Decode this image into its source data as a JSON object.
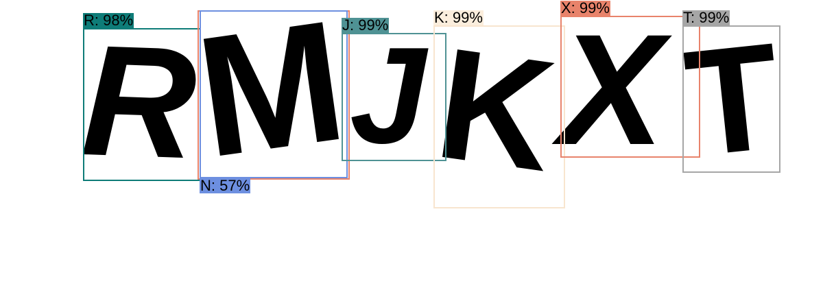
{
  "detections": [
    {
      "letter": "R",
      "label": "R: 98%",
      "color": "#0e7c78"
    },
    {
      "letter": "M",
      "label": "",
      "color": "#e8836b"
    },
    {
      "letter": "N",
      "label": "N: 57%",
      "color": "#6d8fe0"
    },
    {
      "letter": "J",
      "label": "J: 99%",
      "color": "#4f9294"
    },
    {
      "letter": "K",
      "label": "K: 99%",
      "color": "#f8e5cf"
    },
    {
      "letter": "X",
      "label": "X: 99%",
      "color": "#e8836b"
    },
    {
      "letter": "T",
      "label": "T: 99%",
      "color": "#a6a6a6"
    }
  ]
}
